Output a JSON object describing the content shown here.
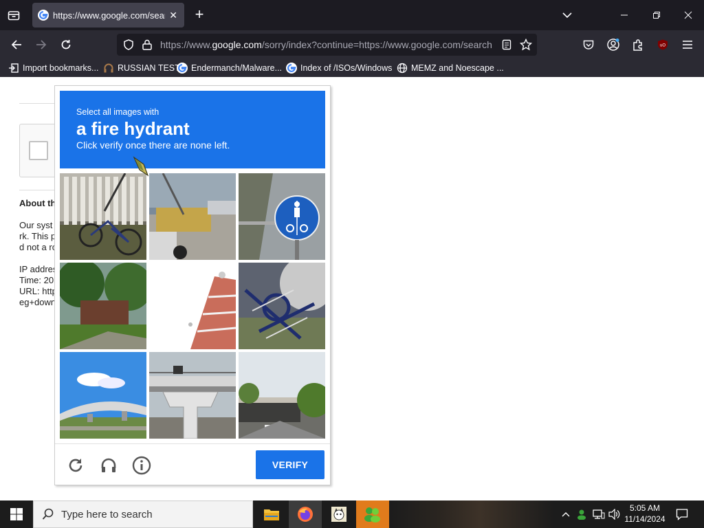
{
  "browser": {
    "tab": {
      "title": "https://www.google.com/search?q="
    },
    "url": {
      "prefix": "https://www.",
      "domain": "google.com",
      "rest": "/sorry/index?continue=https://www.google.com/search"
    },
    "bookmarks": [
      {
        "label": "Import bookmarks...",
        "icon": "import-icon"
      },
      {
        "label": "RUSSIAN TEST",
        "icon": "headphones-icon"
      },
      {
        "label": "Endermanch/Malware...",
        "icon": "google-icon"
      },
      {
        "label": "Index of /ISOs/Windows",
        "icon": "google-icon"
      },
      {
        "label": "MEMZ and Noescape ...",
        "icon": "globe-icon"
      }
    ]
  },
  "page": {
    "about_title": "About th",
    "lines": [
      "Our syst",
      "rk. This p",
      "d not a ro",
      "IP addres",
      "Time: 20",
      "URL: http",
      "eg+down"
    ]
  },
  "captcha": {
    "instruction_small": "Select all images with",
    "target": "a fire hydrant",
    "instruction_sub": "Click verify once there are none left.",
    "verify_label": "VERIFY",
    "tiles": [
      "bicycle by fence",
      "construction barrier street",
      "bicycle path sign",
      "trees and building",
      "building corner",
      "bicycles pile",
      "overpass bridge sky",
      "bridge pillar",
      "road underpass"
    ]
  },
  "taskbar": {
    "search_placeholder": "Type here to search",
    "time": "5:05 AM",
    "date": "11/14/2024"
  },
  "colors": {
    "captcha_blue": "#1a73e8",
    "chrome_dark": "#1c1b22",
    "chrome_mid": "#2b2a33"
  }
}
